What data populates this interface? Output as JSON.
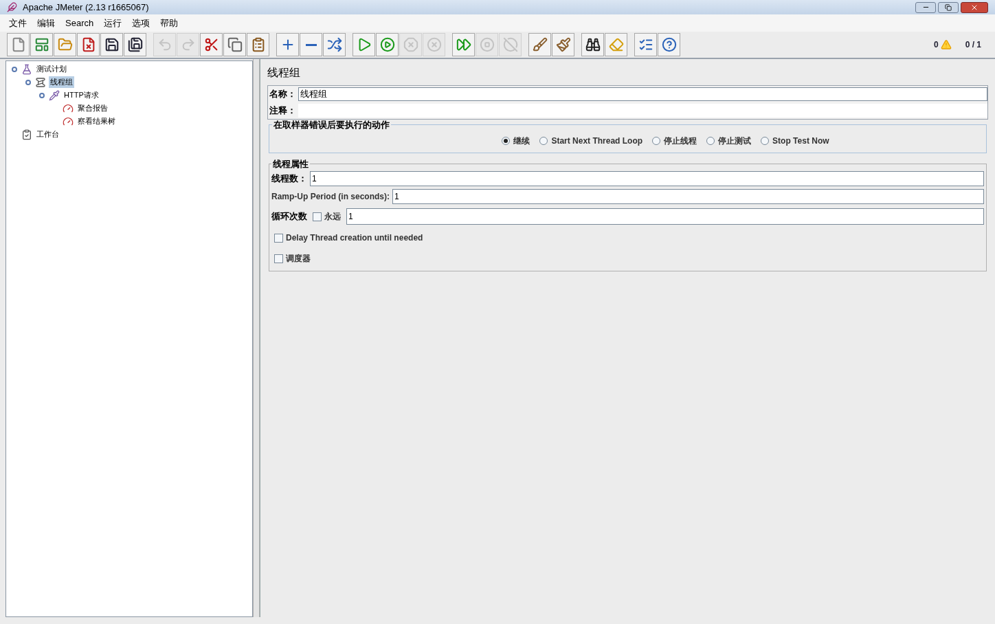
{
  "window": {
    "title": "Apache JMeter (2.13 r1665067)"
  },
  "menu": [
    "文件",
    "编辑",
    "Search",
    "运行",
    "选项",
    "帮助"
  ],
  "toolbar": [
    [
      {
        "kind": "new",
        "disabled": false
      },
      {
        "kind": "templates",
        "disabled": false
      },
      {
        "kind": "open",
        "disabled": false
      },
      {
        "kind": "close",
        "disabled": false
      },
      {
        "kind": "save",
        "disabled": false
      },
      {
        "kind": "saveas",
        "disabled": false
      }
    ],
    [
      {
        "kind": "undo",
        "disabled": true
      },
      {
        "kind": "redo",
        "disabled": true
      },
      {
        "kind": "cut",
        "disabled": false
      },
      {
        "kind": "copy",
        "disabled": false
      },
      {
        "kind": "paste",
        "disabled": false
      }
    ],
    [
      {
        "kind": "expand",
        "disabled": false
      },
      {
        "kind": "collapse",
        "disabled": false
      },
      {
        "kind": "toggle",
        "disabled": false
      }
    ],
    [
      {
        "kind": "start",
        "disabled": false
      },
      {
        "kind": "startnotimer",
        "disabled": false
      },
      {
        "kind": "stop",
        "disabled": true
      },
      {
        "kind": "shutdown",
        "disabled": true
      }
    ],
    [
      {
        "kind": "remotestart",
        "disabled": false
      },
      {
        "kind": "remotestop",
        "disabled": true
      },
      {
        "kind": "remoteshutdown",
        "disabled": true
      }
    ],
    [
      {
        "kind": "clear",
        "disabled": false
      },
      {
        "kind": "clearall",
        "disabled": false
      }
    ],
    [
      {
        "kind": "search",
        "disabled": false
      },
      {
        "kind": "resetsearch",
        "disabled": false
      }
    ],
    [
      {
        "kind": "functions",
        "disabled": false
      },
      {
        "kind": "help",
        "disabled": false
      }
    ]
  ],
  "status": {
    "errors": "0",
    "threads": "0 / 1"
  },
  "tree": [
    {
      "label": "测试计划",
      "kind": "plan",
      "selected": false,
      "children": [
        {
          "label": "线程组",
          "kind": "threadgroup",
          "selected": true,
          "children": [
            {
              "label": "HTTP请求",
              "kind": "sampler",
              "selected": false,
              "children": [
                {
                  "label": "聚合报告",
                  "kind": "listener",
                  "selected": false
                },
                {
                  "label": "察看结果树",
                  "kind": "listener",
                  "selected": false
                }
              ]
            }
          ]
        }
      ]
    },
    {
      "label": "工作台",
      "kind": "workbench",
      "selected": false
    }
  ],
  "panel": {
    "title": "线程组",
    "name_label": "名称：",
    "name_value": "线程组",
    "comment_label": "注释：",
    "error_group": {
      "title": "在取样器错误后要执行的动作",
      "options": [
        {
          "label": "继续",
          "selected": true
        },
        {
          "label": "Start Next Thread Loop",
          "selected": false
        },
        {
          "label": "停止线程",
          "selected": false
        },
        {
          "label": "停止测试",
          "selected": false
        },
        {
          "label": "Stop Test Now",
          "selected": false
        }
      ]
    },
    "thread_group": {
      "title": "线程属性",
      "threads_label": "线程数：",
      "threads_value": "1",
      "rampup_label": "Ramp-Up Period (in seconds):",
      "rampup_value": "1",
      "loop_label": "循环次数",
      "forever": {
        "label": "永远",
        "checked": false
      },
      "loop_value": "1",
      "delay": {
        "label": "Delay Thread creation until needed",
        "checked": false
      },
      "scheduler": {
        "label": "调度器",
        "checked": false
      }
    }
  }
}
